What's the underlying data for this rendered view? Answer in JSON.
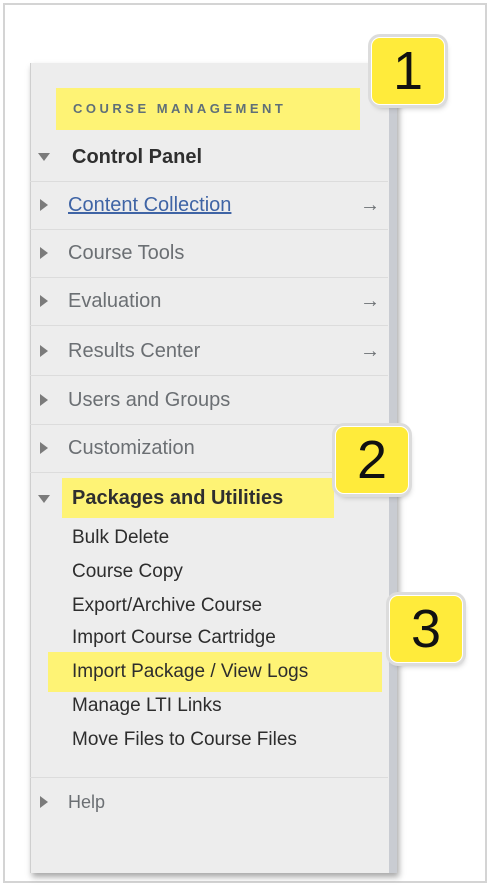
{
  "panel": {
    "header": "COURSE MANAGEMENT",
    "sections": [
      {
        "label": "Control Panel",
        "state": "expanded",
        "style": "strong"
      },
      {
        "label": "Content Collection",
        "state": "collapsed",
        "style": "link",
        "has_arrow": true
      },
      {
        "label": "Course Tools",
        "state": "collapsed"
      },
      {
        "label": "Evaluation",
        "state": "collapsed",
        "has_arrow": true
      },
      {
        "label": "Results Center",
        "state": "collapsed",
        "has_arrow": true
      },
      {
        "label": "Users and Groups",
        "state": "collapsed"
      },
      {
        "label": "Customization",
        "state": "collapsed"
      },
      {
        "label": "Packages and Utilities",
        "state": "expanded",
        "style": "strong"
      }
    ],
    "packages_items": [
      "Bulk Delete",
      "Course Copy",
      "Export/Archive Course",
      "Import Course Cartridge",
      "Import Package / View Logs",
      "Manage LTI Links",
      "Move Files to Course Files"
    ],
    "help": "Help",
    "arrow_glyph": "→"
  },
  "callouts": {
    "one": "1",
    "two": "2",
    "three": "3"
  },
  "colors": {
    "highlight": "#fff36a",
    "badge": "#ffeb3b",
    "panel_bg": "#ededed",
    "link": "#3f64a5"
  }
}
